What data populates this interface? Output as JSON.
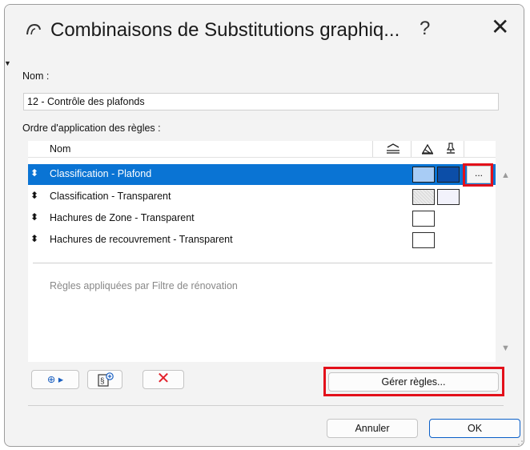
{
  "window": {
    "title": "Combinaisons de Substitutions graphiq...",
    "help_label": "?",
    "close_label": "✕"
  },
  "name_section": {
    "label": "Nom :",
    "value": "12 - Contrôle des plafonds"
  },
  "rules_section": {
    "label": "Ordre d'application des règles :",
    "column_name": "Nom",
    "column_icons": [
      "layers-icon",
      "fill-icon",
      "pen-icon"
    ],
    "rows": [
      {
        "label": "Classification - Plafond",
        "selected": true,
        "swatches": [
          "light-blue",
          "dark-blue"
        ],
        "more": "..."
      },
      {
        "label": "Classification - Transparent",
        "selected": false,
        "swatches": [
          "dotted-gray",
          "light-lavender"
        ]
      },
      {
        "label": "Hachures de Zone - Transparent",
        "selected": false,
        "swatches": [
          "white"
        ]
      },
      {
        "label": "Hachures de recouvrement - Transparent",
        "selected": false,
        "swatches": [
          "white"
        ]
      }
    ],
    "renovation_text": "Règles appliquées par Filtre de rénovation"
  },
  "toolbar": {
    "add_label": "⊕ ▸",
    "manage_rules_label": "Gérer règles..."
  },
  "footer": {
    "cancel_label": "Annuler",
    "ok_label": "OK"
  },
  "colors": {
    "selection": "#0a74d4",
    "highlight": "#e3101a",
    "swatch_light_blue": "#a8ccf5",
    "swatch_dark_blue": "#0c4ea8",
    "delete_red": "#e3202a"
  }
}
